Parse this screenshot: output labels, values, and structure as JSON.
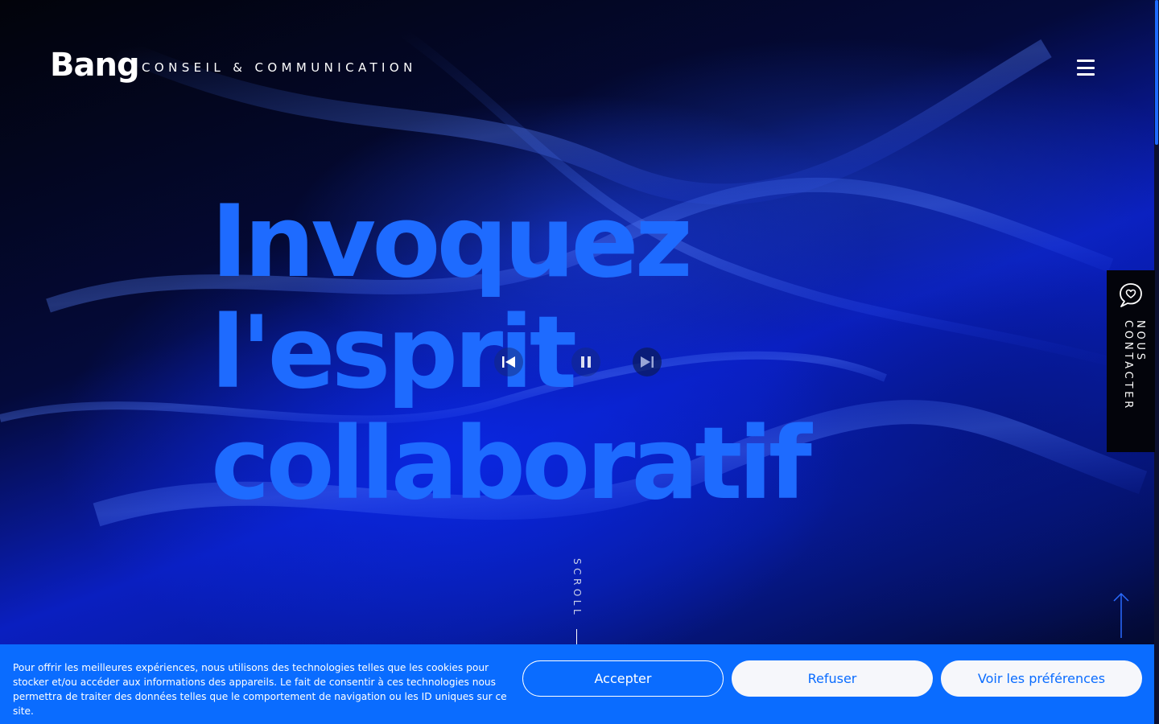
{
  "header": {
    "logo": "Bang",
    "tagline": "CONSEIL & COMMUNICATION",
    "menu_icon": "hamburger-menu-icon"
  },
  "hero": {
    "headline_lines": [
      "Invoquez",
      "l'esprit",
      "collaboratif"
    ],
    "scroll_label": "SCROLL",
    "video_controls": {
      "previous_icon": "skip-previous-icon",
      "pause_icon": "pause-icon",
      "next_icon": "skip-next-icon"
    }
  },
  "contact_tab": {
    "label": "NOUS CONTACTER",
    "icon": "heart-chat-icon"
  },
  "back_to_top": {
    "icon": "arrow-up-icon"
  },
  "cookie_banner": {
    "text": "Pour offrir les meilleures expériences, nous utilisons des technologies telles que les cookies pour stocker et/ou accéder aux informations des appareils. Le fait de consentir à ces technologies nous permettra de traiter des données telles que le comportement de navigation ou les ID uniques sur ce site.",
    "accept_label": "Accepter",
    "refuse_label": "Refuser",
    "preferences_label": "Voir les préférences"
  },
  "colors": {
    "accent": "#1e6bff",
    "banner_bg": "#0a6cff",
    "background": "#02040f"
  }
}
